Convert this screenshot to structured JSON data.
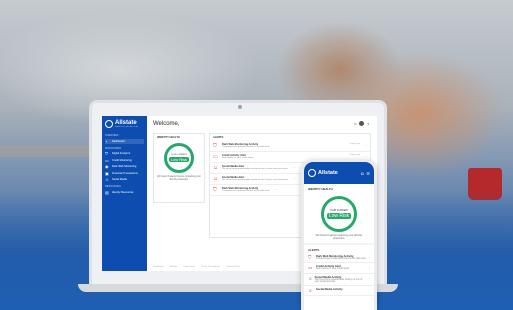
{
  "brand": {
    "name": "Allstate",
    "tagline": "IDENTITY PROTECTION"
  },
  "dashboard": {
    "welcome": "Welcome,",
    "user_initial": "G",
    "sidebar": {
      "overview_section": "OVERVIEW",
      "overview_items": [
        {
          "icon": "dashboard-icon",
          "label": "Dashboard"
        }
      ],
      "monitoring_section": "MONITORING",
      "monitoring_items": [
        {
          "icon": "shield-icon",
          "label": "Digital Footprint"
        },
        {
          "icon": "credit-card-icon",
          "label": "Credit Monitoring"
        },
        {
          "icon": "eye-icon",
          "label": "Dark Web Monitoring"
        },
        {
          "icon": "lock-icon",
          "label": "Financial Transactions"
        },
        {
          "icon": "people-icon",
          "label": "Social Media"
        }
      ],
      "resources_section": "RESOURCES",
      "resources_items": [
        {
          "icon": "book-icon",
          "label": "Identity Resources"
        }
      ]
    },
    "health_card": {
      "title": "IDENTITY HEALTH",
      "dial_caption": "YOUR CURRENT",
      "status": "Low Risk",
      "description": "We found 0 alerts that are impacting your identity protection."
    },
    "alerts_card": {
      "title": "ALERTS",
      "items": [
        {
          "title": "Dark Web Monitoring Activity",
          "desc": "Compromised credentials found on the dark web",
          "time": "2 days ago"
        },
        {
          "title": "Credit Activity Alert",
          "desc": "New inquiry on your credit report",
          "time": "3 days ago"
        },
        {
          "title": "Social Media Alert",
          "desc": "We found some questionable activity on one of your social accounts",
          "time": ""
        },
        {
          "title": "Social Media Alert",
          "desc": "We found some questionable activity on one of your social accounts",
          "time": ""
        },
        {
          "title": "Dark Web Monitoring Activity",
          "desc": "Compromised credentials found on the dark web",
          "time": ""
        }
      ]
    },
    "footer_links": [
      "Dashboard",
      "Settings",
      "Help Center",
      "Terms & Conditions",
      "Privacy Policy"
    ],
    "copyright": "© 2020 Allstate Insurance Company"
  },
  "phone": {
    "health_title": "IDENTITY HEALTH",
    "dial_caption": "YOUR CURRENT",
    "status": "Low Risk",
    "description": "We found 0 alerts impacting your identity protection.",
    "alerts_title": "ALERTS",
    "alerts": [
      {
        "title": "Dark Web Monitoring Activity",
        "desc": "Compromised credentials found on the dark web"
      },
      {
        "title": "Credit Activity Alert",
        "desc": "New inquiry on your credit report"
      },
      {
        "title": "Social Media Activity",
        "desc": "We found some questionable activity on one of your social accounts"
      },
      {
        "title": "Social Media Activity",
        "desc": ""
      }
    ]
  },
  "colors": {
    "brand_blue": "#0d4db0",
    "risk_green": "#26a86a",
    "alert_red": "#d23a3a"
  }
}
